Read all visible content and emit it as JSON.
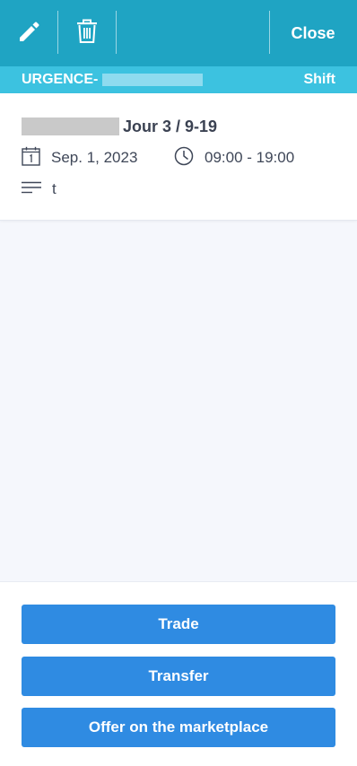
{
  "toolbar": {
    "edit_icon": "pencil-icon",
    "delete_icon": "trash-icon",
    "close_label": "Close"
  },
  "subheader": {
    "department": "URGENCE-",
    "type": "Shift"
  },
  "shift": {
    "title": "Jour 3 / 9-19",
    "date": "Sep. 1, 2023",
    "time": "09:00 - 19:00",
    "description": "t"
  },
  "actions": {
    "trade_label": "Trade",
    "transfer_label": "Transfer",
    "marketplace_label": "Offer on the marketplace"
  },
  "colors": {
    "toolbar_bg": "#1fa4c3",
    "subheader_bg": "#3cc2e0",
    "button_bg": "#2f8be2",
    "page_bg": "#f5f7fc"
  }
}
